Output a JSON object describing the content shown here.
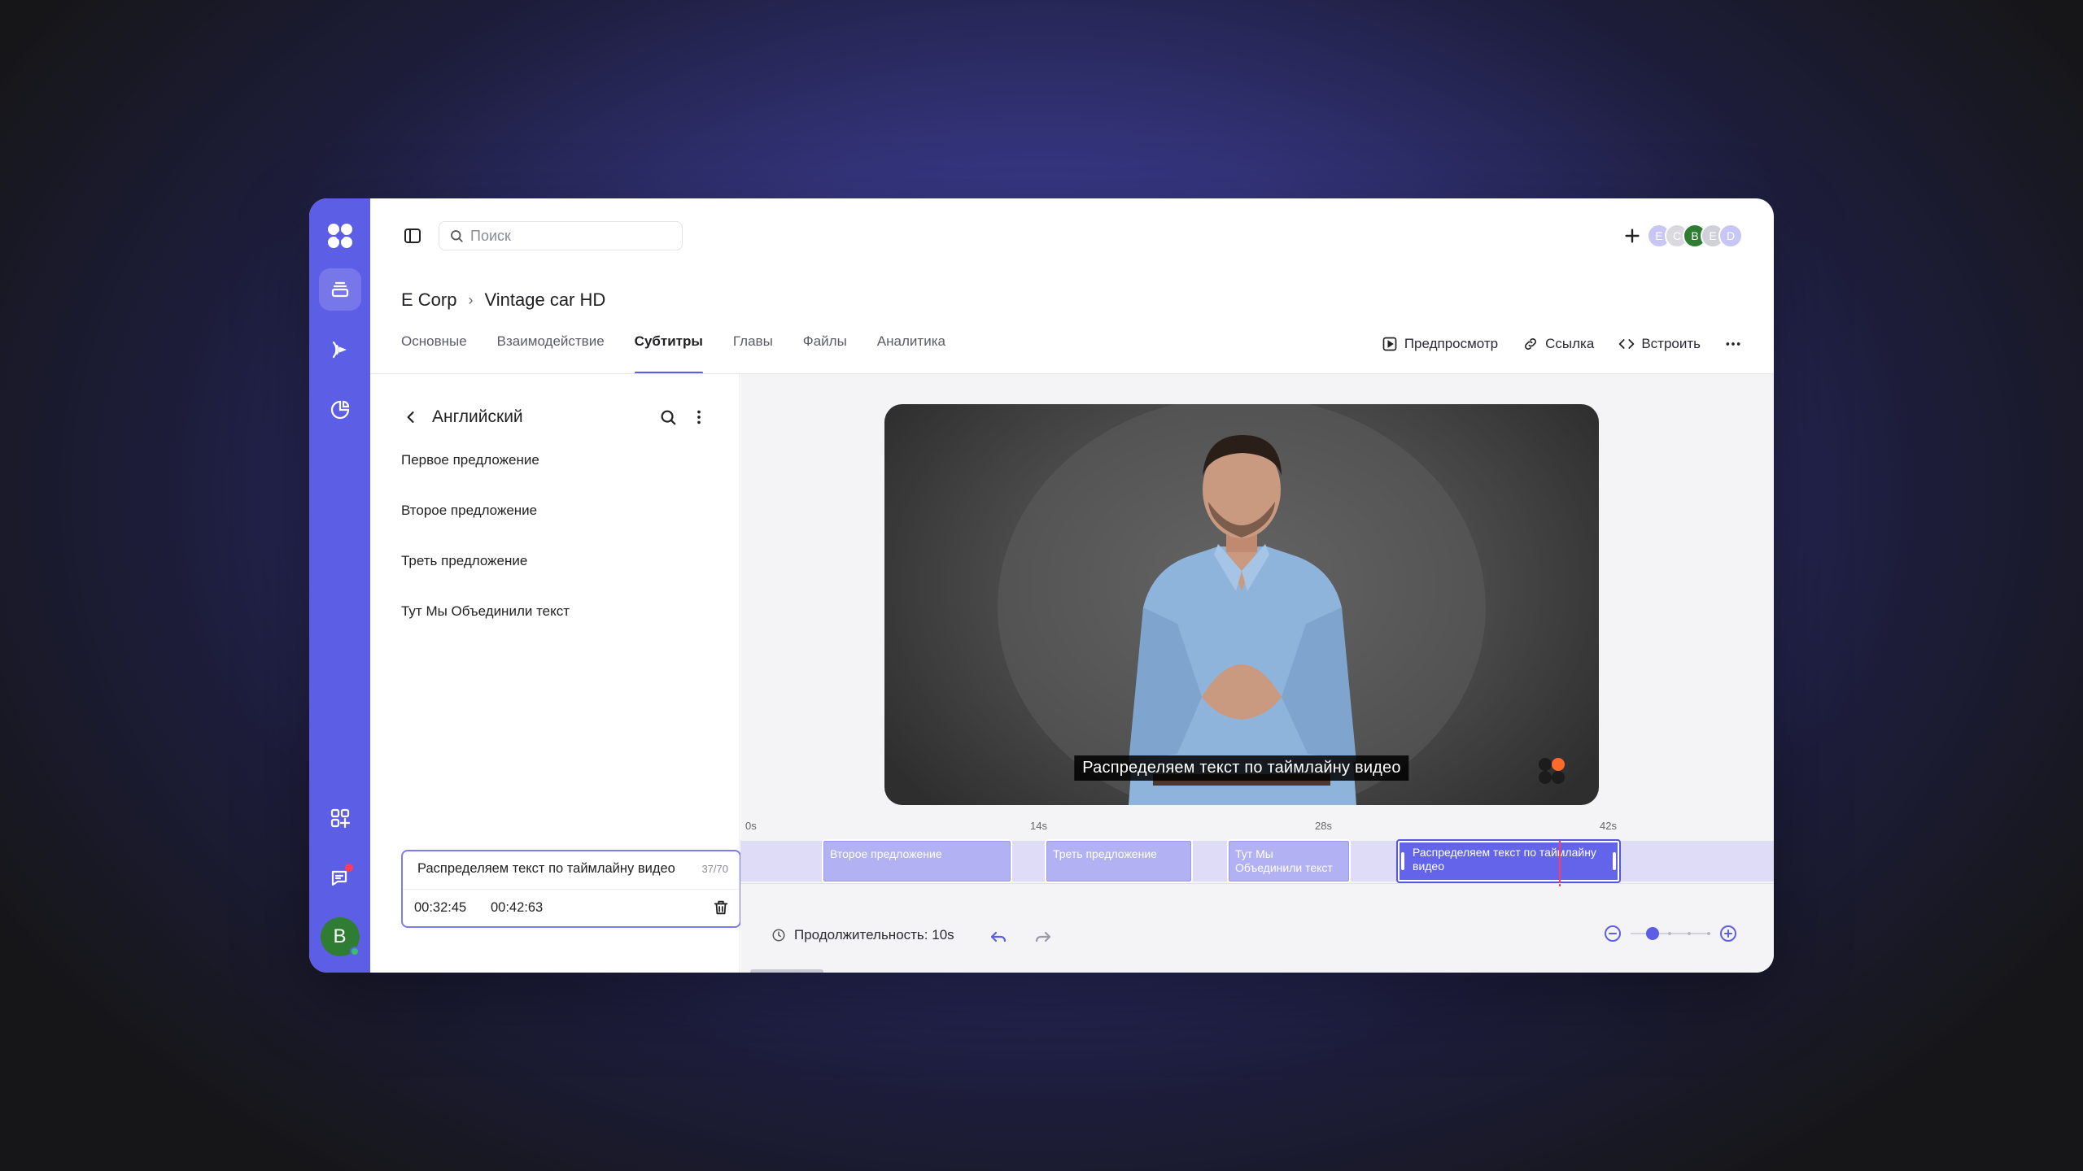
{
  "colors": {
    "accent": "#5d5ee6",
    "clip": "#b2b1f3",
    "clip_active": "#6364ea",
    "playhead": "#ff3b5c"
  },
  "rail": {
    "icons": [
      "app-logo-icon",
      "library-icon",
      "broadcast-icon",
      "analytics-icon",
      "apps-icon",
      "chat-icon"
    ],
    "user_initial": "B"
  },
  "search": {
    "placeholder": "Поиск"
  },
  "collaborators": [
    {
      "initial": "E",
      "color": "#c8c6f5"
    },
    {
      "initial": "C",
      "color": "#d9d9df"
    },
    {
      "initial": "B",
      "color": "#2e7d32"
    },
    {
      "initial": "E",
      "color": "#cfd0da"
    },
    {
      "initial": "D",
      "color": "#c8c6f5"
    }
  ],
  "breadcrumb": {
    "org": "E Corp",
    "title": "Vintage car HD"
  },
  "tabs": [
    {
      "label": "Основные",
      "active": false
    },
    {
      "label": "Взаимодействие",
      "active": false
    },
    {
      "label": "Субтитры",
      "active": true
    },
    {
      "label": "Главы",
      "active": false
    },
    {
      "label": "Файлы",
      "active": false
    },
    {
      "label": "Аналитика",
      "active": false
    }
  ],
  "actions": {
    "preview": "Предпросмотр",
    "link": "Ссылка",
    "embed": "Встроить"
  },
  "panel": {
    "language": "Английский",
    "items": [
      "Первое предложение",
      "Второе предложение",
      "Треть предложение",
      "Тут Мы Объединили текст"
    ],
    "editing": {
      "text": "Распределяем текст по таймлайну видео",
      "count": "37/70",
      "start": "00:32:45",
      "end": "00:42:63"
    }
  },
  "video": {
    "caption": "Распределяем текст по таймлайну видео"
  },
  "timeline": {
    "ticks": [
      "0s",
      "14s",
      "28s",
      "42s"
    ],
    "clips": [
      {
        "label": "Второе предложение",
        "active": false
      },
      {
        "label": "Треть предложение",
        "active": false
      },
      {
        "label": "Тут Мы Объединили текст",
        "active": false
      },
      {
        "label": "Распределяем текст по таймлайну видео",
        "active": true
      }
    ]
  },
  "footer": {
    "duration": "Продолжительность: 10s"
  }
}
